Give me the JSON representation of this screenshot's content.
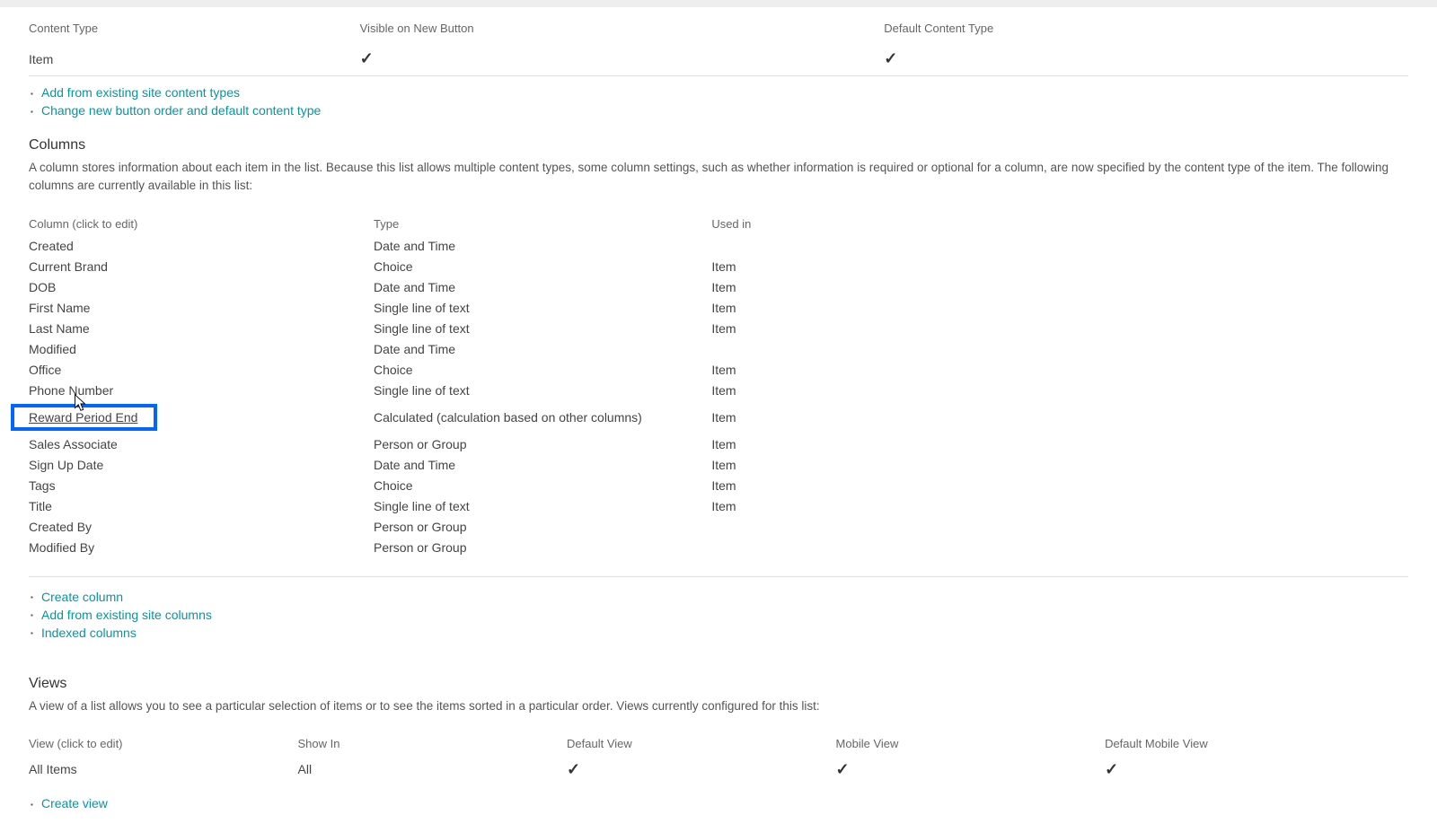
{
  "contentTypes": {
    "headers": {
      "name": "Content Type",
      "visibleOnNew": "Visible on New Button",
      "defaultType": "Default Content Type"
    },
    "rows": [
      {
        "name": "Item",
        "visibleCheck": "✓",
        "defaultCheck": "✓"
      }
    ],
    "actions": {
      "addExisting": "Add from existing site content types",
      "changeOrder": "Change new button order and default content type"
    }
  },
  "columnsSection": {
    "heading": "Columns",
    "description": "A column stores information about each item in the list. Because this list allows multiple content types, some column settings, such as whether information is required or optional for a column, are now specified by the content type of the item. The following columns are currently available in this list:",
    "headers": {
      "column": "Column (click to edit)",
      "type": "Type",
      "usedIn": "Used in"
    },
    "rows": [
      {
        "name": "Created",
        "type": "Date and Time",
        "usedIn": ""
      },
      {
        "name": "Current Brand",
        "type": "Choice",
        "usedIn": "Item"
      },
      {
        "name": "DOB",
        "type": "Date and Time",
        "usedIn": "Item"
      },
      {
        "name": "First Name",
        "type": "Single line of text",
        "usedIn": "Item"
      },
      {
        "name": "Last Name",
        "type": "Single line of text",
        "usedIn": "Item"
      },
      {
        "name": "Modified",
        "type": "Date and Time",
        "usedIn": ""
      },
      {
        "name": "Office",
        "type": "Choice",
        "usedIn": "Item"
      },
      {
        "name": "Phone Number",
        "type": "Single line of text",
        "usedIn": "Item"
      },
      {
        "name": "Reward Period End",
        "type": "Calculated (calculation based on other columns)",
        "usedIn": "Item"
      },
      {
        "name": "Sales Associate",
        "type": "Person or Group",
        "usedIn": "Item"
      },
      {
        "name": "Sign Up Date",
        "type": "Date and Time",
        "usedIn": "Item"
      },
      {
        "name": "Tags",
        "type": "Choice",
        "usedIn": "Item"
      },
      {
        "name": "Title",
        "type": "Single line of text",
        "usedIn": "Item"
      },
      {
        "name": "Created By",
        "type": "Person or Group",
        "usedIn": ""
      },
      {
        "name": "Modified By",
        "type": "Person or Group",
        "usedIn": ""
      }
    ],
    "actions": {
      "createColumn": "Create column",
      "addFromExisting": "Add from existing site columns",
      "indexedColumns": "Indexed columns"
    }
  },
  "viewsSection": {
    "heading": "Views",
    "description": "A view of a list allows you to see a particular selection of items or to see the items sorted in a particular order. Views currently configured for this list:",
    "headers": {
      "view": "View (click to edit)",
      "showIn": "Show In",
      "defaultView": "Default View",
      "mobileView": "Mobile View",
      "defaultMobileView": "Default Mobile View"
    },
    "rows": [
      {
        "name": "All Items",
        "showIn": "All",
        "defaultView": "✓",
        "mobileView": "✓",
        "defaultMobileView": "✓"
      }
    ],
    "actions": {
      "createView": "Create view"
    }
  }
}
